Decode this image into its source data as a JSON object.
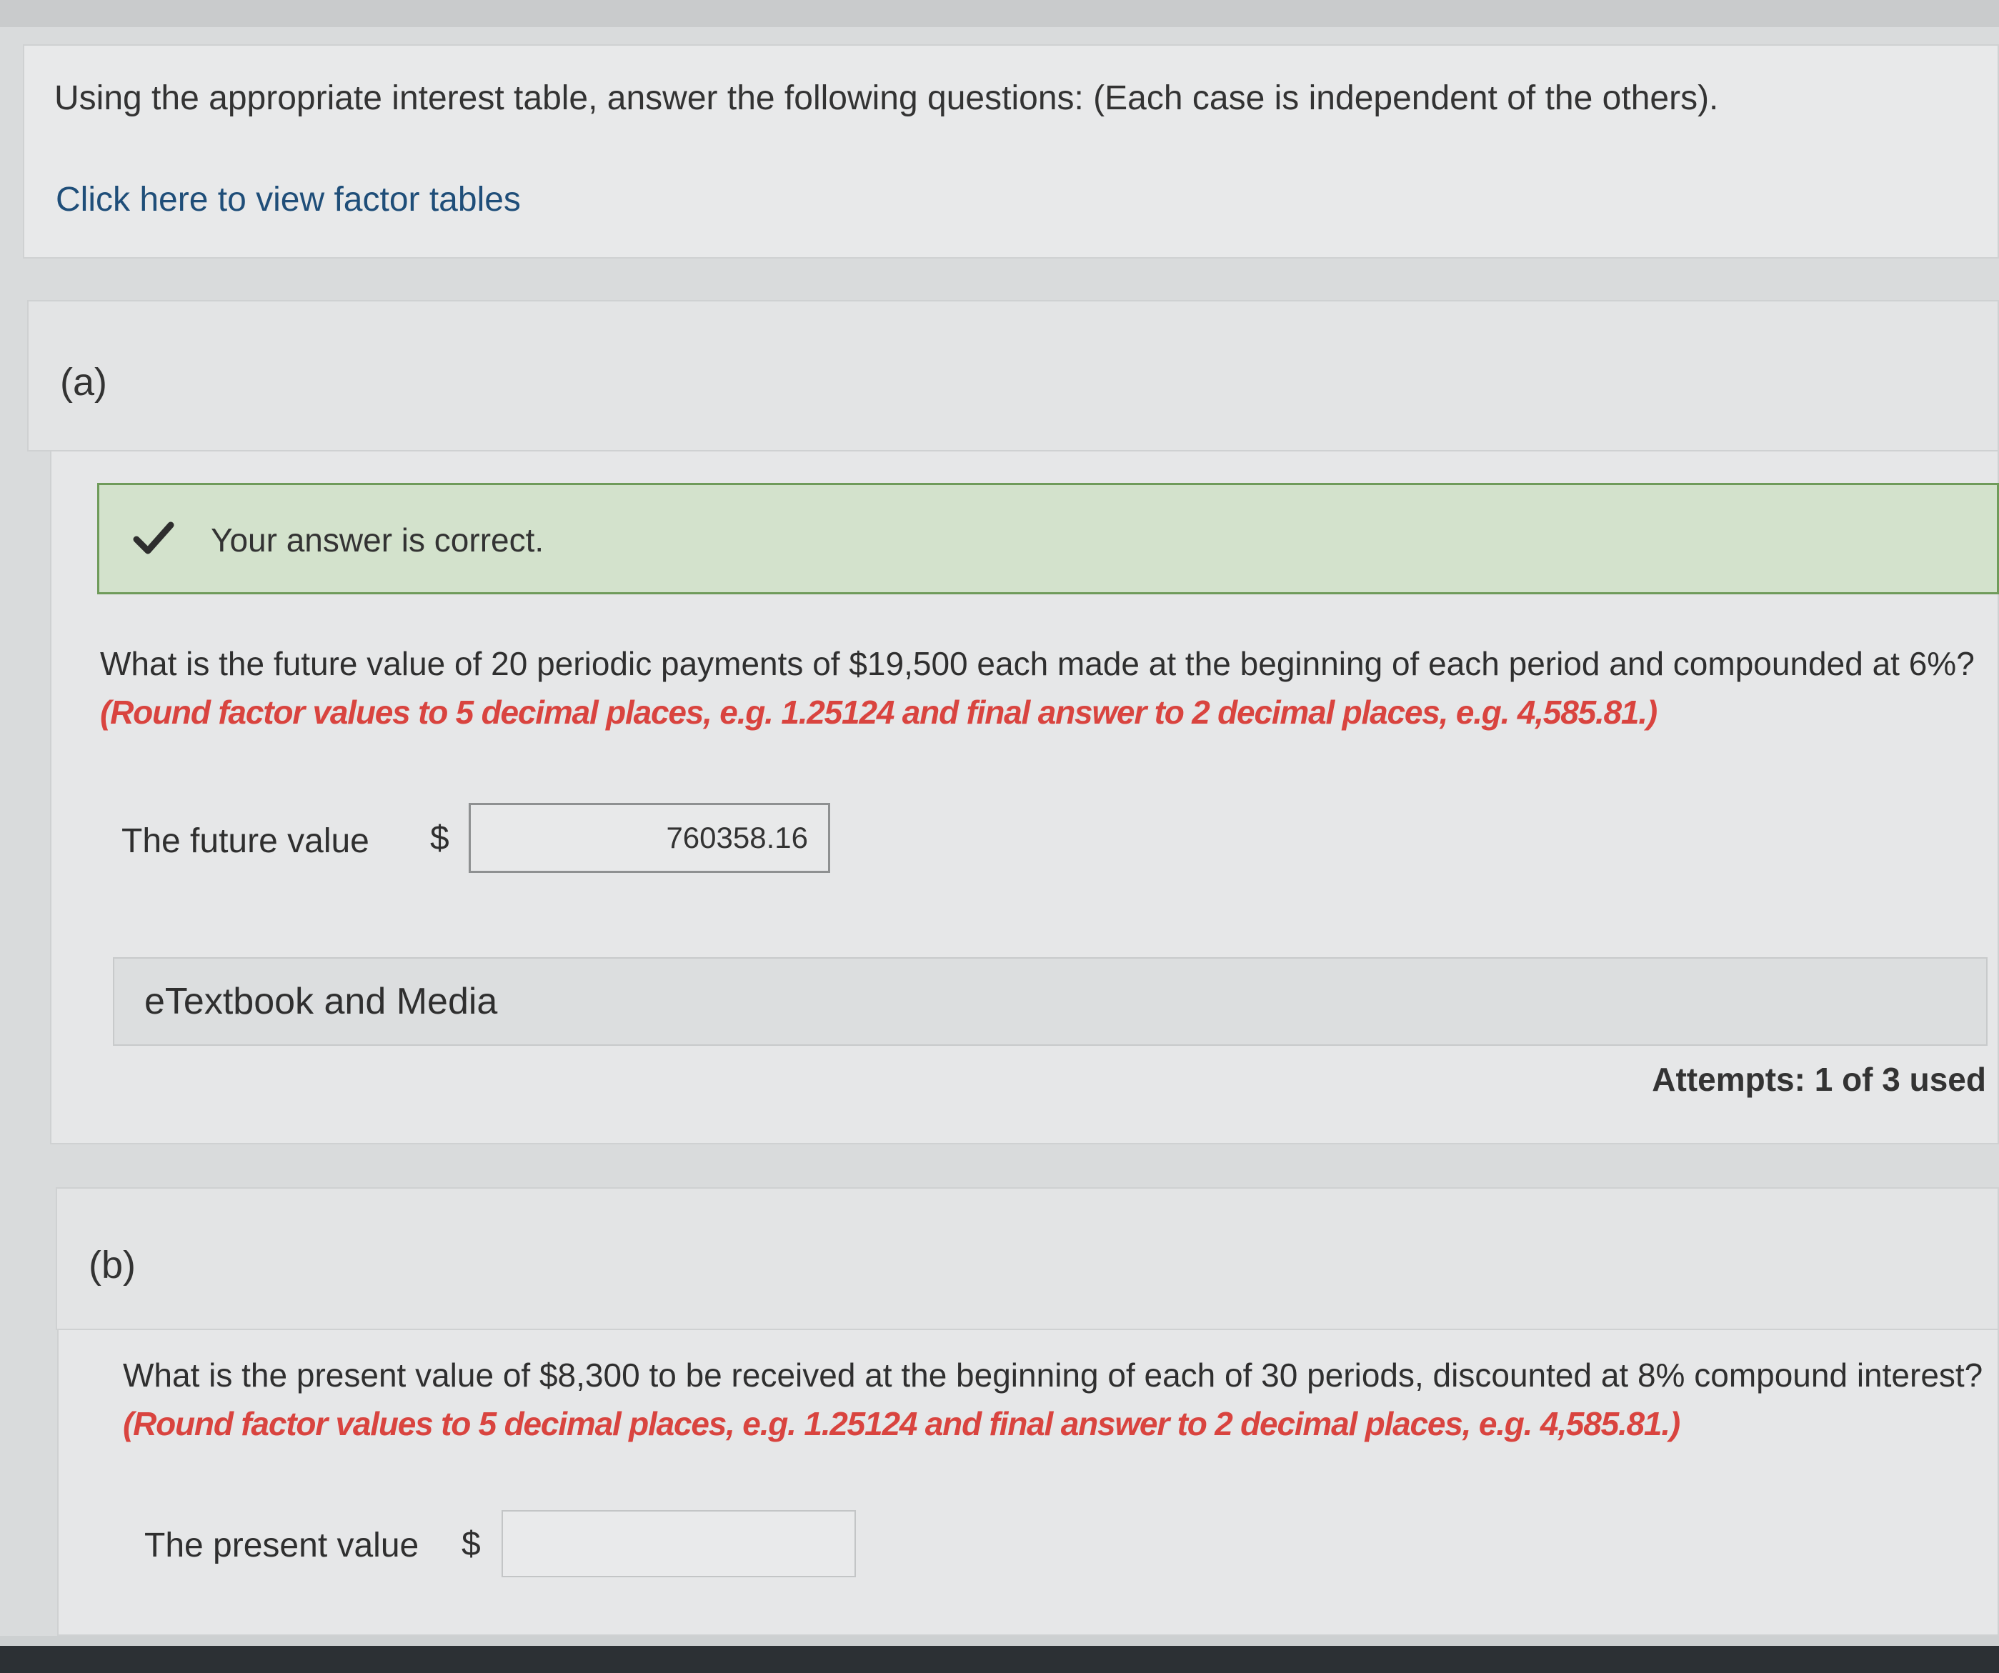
{
  "intro": {
    "prompt": "Using the appropriate interest table, answer the following questions: (Each case is independent of the others).",
    "factor_tables_link": "Click here to view factor tables"
  },
  "part_a": {
    "label": "(a)",
    "feedback": "Your answer is correct.",
    "question": "What is the future value of 20 periodic payments of $19,500 each made at the beginning of each period and compounded at 6%?",
    "hint": "(Round factor values to 5 decimal places, e.g. 1.25124 and final answer to 2 decimal places, e.g. 4,585.81.)",
    "field_label": "The future value",
    "currency": "$",
    "answer_value": "760358.16",
    "etextbook_label": "eTextbook and Media",
    "attempts": "Attempts: 1 of 3 used"
  },
  "part_b": {
    "label": "(b)",
    "question": "What is the present value of $8,300 to be received at the beginning of each of 30 periods, discounted at 8% compound interest?",
    "hint": "(Round factor values to 5 decimal places, e.g. 1.25124 and final answer to 2 decimal places, e.g. 4,585.81.)",
    "field_label": "The present value",
    "currency": "$",
    "answer_value": ""
  },
  "colors": {
    "hint_red": "#d9443f",
    "success_bg": "#d3e2cc",
    "success_border": "#6f9b5a",
    "link_blue": "#1f4e79"
  },
  "icons": {
    "feedback": "check-icon"
  }
}
